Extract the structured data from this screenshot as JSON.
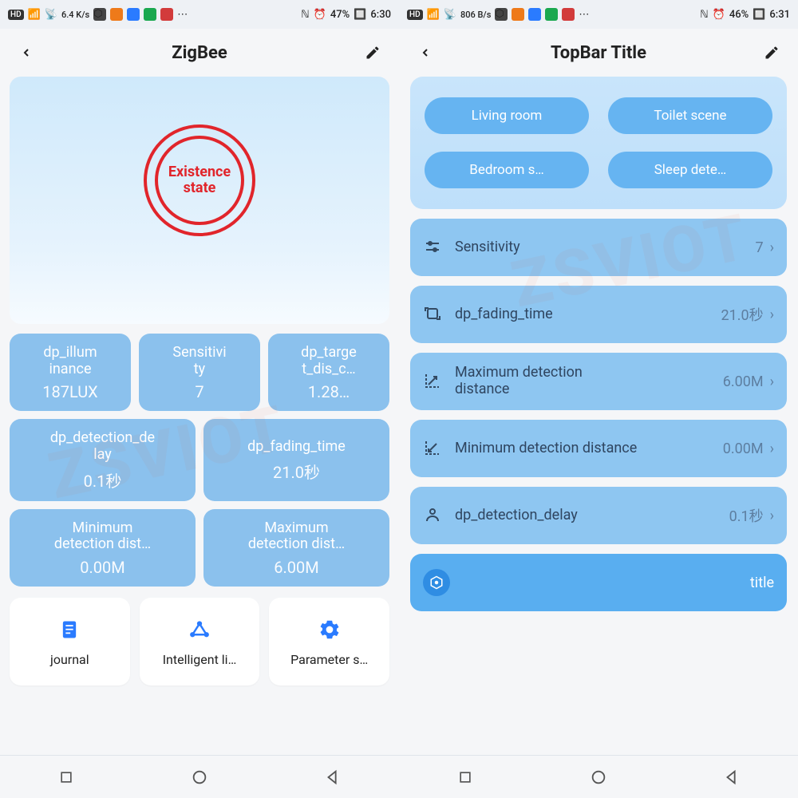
{
  "left": {
    "status": {
      "net_speed": "6.4 K/s",
      "battery": "47%",
      "time": "6:30"
    },
    "topbar": {
      "title": "ZigBee"
    },
    "hero": {
      "existence_label": "Existence\nstate"
    },
    "dp_row3": [
      {
        "label": "dp_illum\ninance",
        "value": "187LUX"
      },
      {
        "label": "Sensitivi\nty",
        "value": "7"
      },
      {
        "label": "dp_targe\nt_dis_c…",
        "value": "1.28…"
      }
    ],
    "dp_row2a": [
      {
        "label": "dp_detection_de\nlay",
        "value": "0.1秒"
      },
      {
        "label": "dp_fading_time",
        "value": "21.0秒"
      }
    ],
    "dp_row2b": [
      {
        "label": "Minimum\ndetection dist…",
        "value": "0.00M"
      },
      {
        "label": "Maximum\ndetection dist…",
        "value": "6.00M"
      }
    ],
    "bottom": [
      {
        "label": "journal"
      },
      {
        "label": "Intelligent li…"
      },
      {
        "label": "Parameter s…"
      }
    ]
  },
  "right": {
    "status": {
      "net_speed": "806 B/s",
      "battery": "46%",
      "time": "6:31"
    },
    "topbar": {
      "title": "TopBar Title"
    },
    "scenes": [
      "Living room",
      "Toilet scene",
      "Bedroom s…",
      "Sleep dete…"
    ],
    "settings": [
      {
        "label": "Sensitivity",
        "value": "7"
      },
      {
        "label": "dp_fading_time",
        "value": "21.0秒"
      },
      {
        "label": "Maximum detection distance",
        "value": "6.00M"
      },
      {
        "label": "Minimum detection distance",
        "value": "0.00M"
      },
      {
        "label": "dp_detection_delay",
        "value": "0.1秒"
      }
    ],
    "title_row": {
      "label": "title"
    }
  },
  "icons": {
    "hd": "HD",
    "fourg": "4G"
  }
}
